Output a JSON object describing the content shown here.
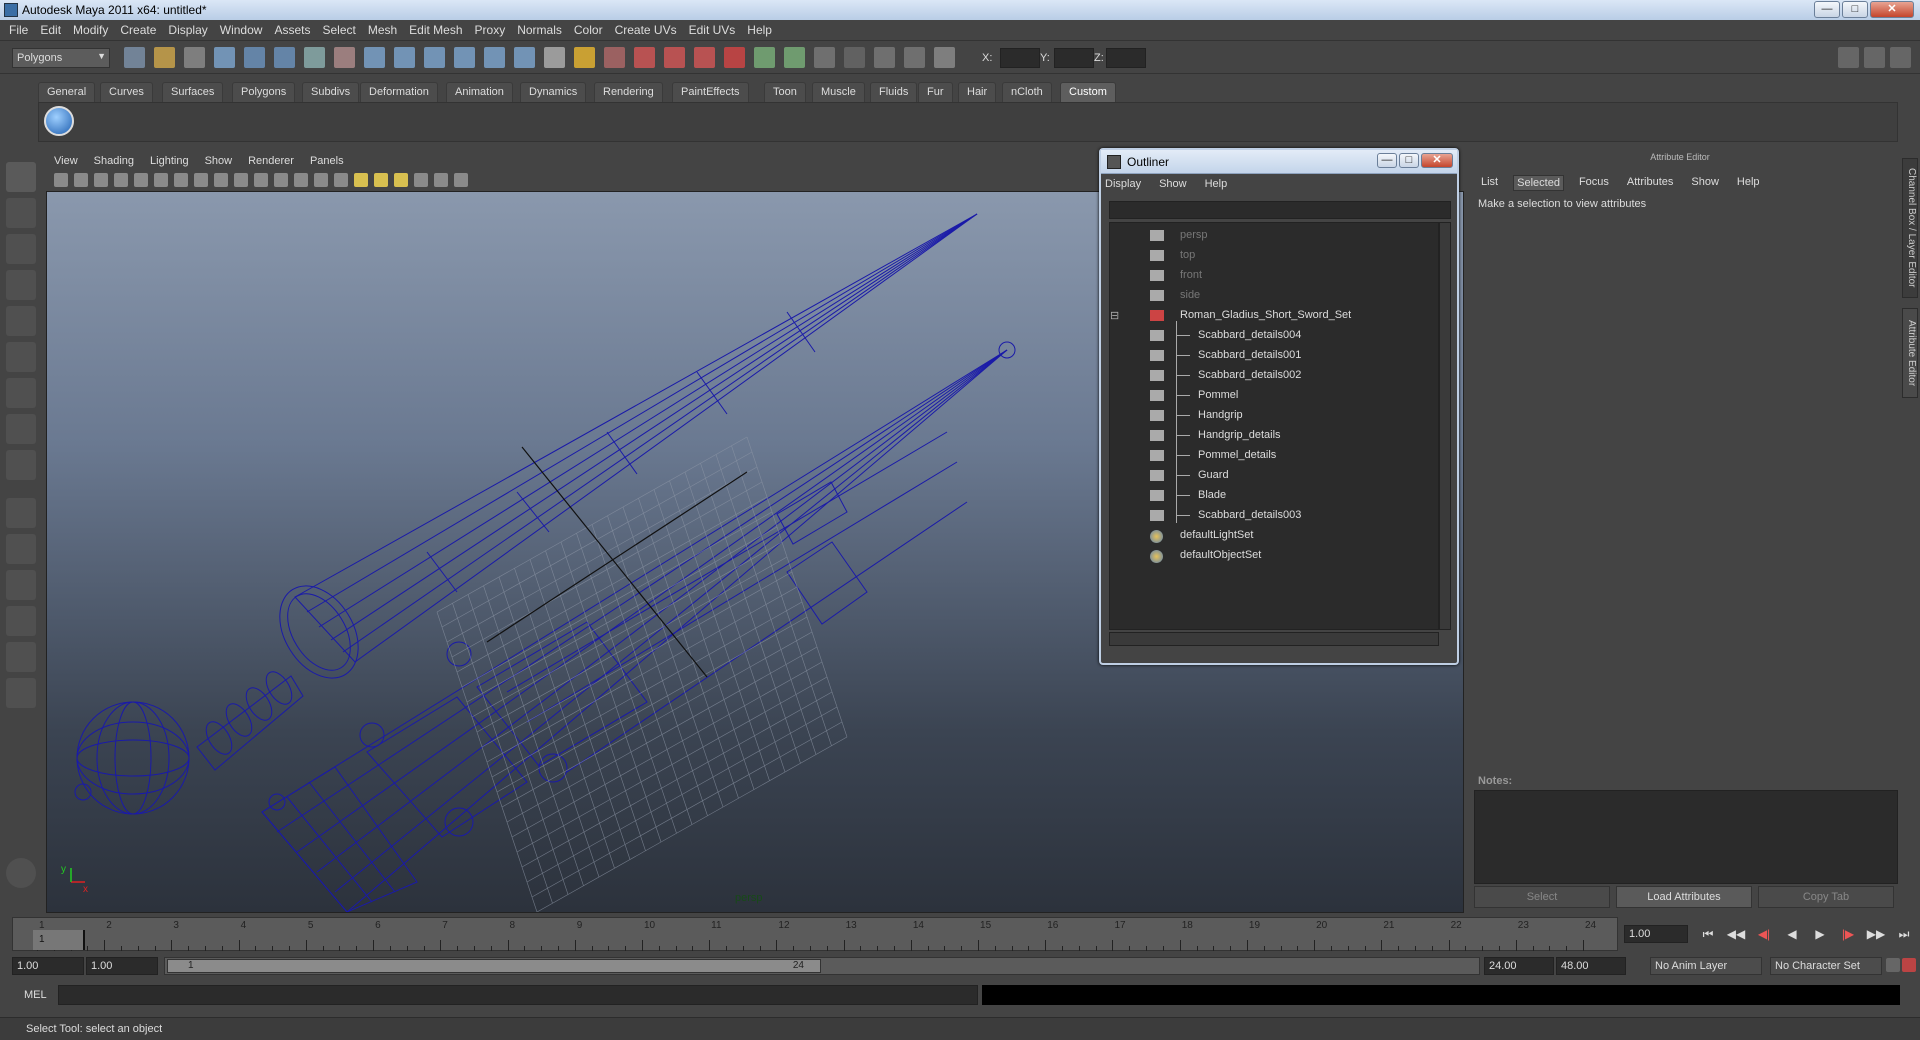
{
  "window": {
    "title": "Autodesk Maya 2011 x64: untitled*"
  },
  "menubar": [
    "File",
    "Edit",
    "Modify",
    "Create",
    "Display",
    "Window",
    "Assets",
    "Select",
    "Mesh",
    "Edit Mesh",
    "Proxy",
    "Normals",
    "Color",
    "Create UVs",
    "Edit UVs",
    "Help"
  ],
  "statusline": {
    "mode": "Polygons",
    "x_label": "X:",
    "y_label": "Y:",
    "z_label": "Z:"
  },
  "shelf": {
    "tabs": [
      "General",
      "Curves",
      "Surfaces",
      "Polygons",
      "Subdivs",
      "Deformation",
      "Animation",
      "Dynamics",
      "Rendering",
      "PaintEffects",
      "Toon",
      "Muscle",
      "Fluids",
      "Fur",
      "Hair",
      "nCloth",
      "Custom"
    ],
    "active": "Custom"
  },
  "viewport": {
    "menu": [
      "View",
      "Shading",
      "Lighting",
      "Show",
      "Renderer",
      "Panels"
    ],
    "camera_label": "persp",
    "axis_x": "x",
    "axis_y": "y",
    "wire_color": "#1a1aa8"
  },
  "outliner": {
    "title": "Outliner",
    "menu": [
      "Display",
      "Show",
      "Help"
    ],
    "items": [
      {
        "label": "persp",
        "type": "camera",
        "dim": true,
        "indent": 0
      },
      {
        "label": "top",
        "type": "camera",
        "dim": true,
        "indent": 0
      },
      {
        "label": "front",
        "type": "camera",
        "dim": true,
        "indent": 0
      },
      {
        "label": "side",
        "type": "camera",
        "dim": true,
        "indent": 0
      },
      {
        "label": "Roman_Gladius_Short_Sword_Set",
        "type": "group",
        "dim": false,
        "indent": 0
      },
      {
        "label": "Scabbard_details004",
        "type": "mesh",
        "dim": false,
        "indent": 1
      },
      {
        "label": "Scabbard_details001",
        "type": "mesh",
        "dim": false,
        "indent": 1
      },
      {
        "label": "Scabbard_details002",
        "type": "mesh",
        "dim": false,
        "indent": 1
      },
      {
        "label": "Pommel",
        "type": "mesh",
        "dim": false,
        "indent": 1
      },
      {
        "label": "Handgrip",
        "type": "mesh",
        "dim": false,
        "indent": 1
      },
      {
        "label": "Handgrip_details",
        "type": "mesh",
        "dim": false,
        "indent": 1
      },
      {
        "label": "Pommel_details",
        "type": "mesh",
        "dim": false,
        "indent": 1
      },
      {
        "label": "Guard",
        "type": "mesh",
        "dim": false,
        "indent": 1
      },
      {
        "label": "Blade",
        "type": "mesh",
        "dim": false,
        "indent": 1
      },
      {
        "label": "Scabbard_details003",
        "type": "mesh",
        "dim": false,
        "indent": 1
      },
      {
        "label": "defaultLightSet",
        "type": "set",
        "dim": false,
        "indent": 0
      },
      {
        "label": "defaultObjectSet",
        "type": "set",
        "dim": false,
        "indent": 0
      }
    ]
  },
  "attribute_editor": {
    "header": "Attribute Editor",
    "menu": [
      "List",
      "Selected",
      "Focus",
      "Attributes",
      "Show",
      "Help"
    ],
    "selected_menu": "Selected",
    "message": "Make a selection to view attributes",
    "notes_label": "Notes:",
    "buttons": {
      "select": "Select",
      "load": "Load Attributes",
      "copy": "Copy Tab"
    },
    "side_tabs": [
      "Channel Box / Layer Editor",
      "Attribute Editor"
    ]
  },
  "timeline": {
    "ticks": [
      "1",
      "2",
      "3",
      "4",
      "5",
      "6",
      "7",
      "8",
      "9",
      "10",
      "11",
      "12",
      "13",
      "14",
      "15",
      "16",
      "17",
      "18",
      "19",
      "20",
      "21",
      "22",
      "23",
      "24"
    ],
    "current_frame_marker": "1",
    "current_frame": "1.00"
  },
  "range": {
    "start": "1.00",
    "playback_start": "1.00",
    "handle_start": "1",
    "handle_end": "24",
    "playback_end": "24.00",
    "end": "48.00",
    "anim_layer": "No Anim Layer",
    "character_set": "No Character Set"
  },
  "commandline": {
    "label": "MEL"
  },
  "helpline": {
    "text": "Select Tool: select an object"
  }
}
